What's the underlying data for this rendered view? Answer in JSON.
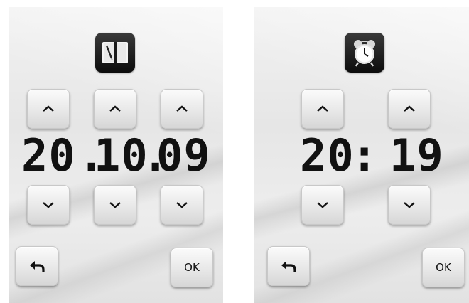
{
  "date_panel": {
    "icon": "notebook-icon",
    "day": "20",
    "month": "10",
    "year": "09",
    "separator": ".",
    "ok_label": "OK"
  },
  "time_panel": {
    "icon": "alarm-clock-icon",
    "hours": "20",
    "minutes": "19",
    "separator": ":",
    "ok_label": "OK"
  }
}
